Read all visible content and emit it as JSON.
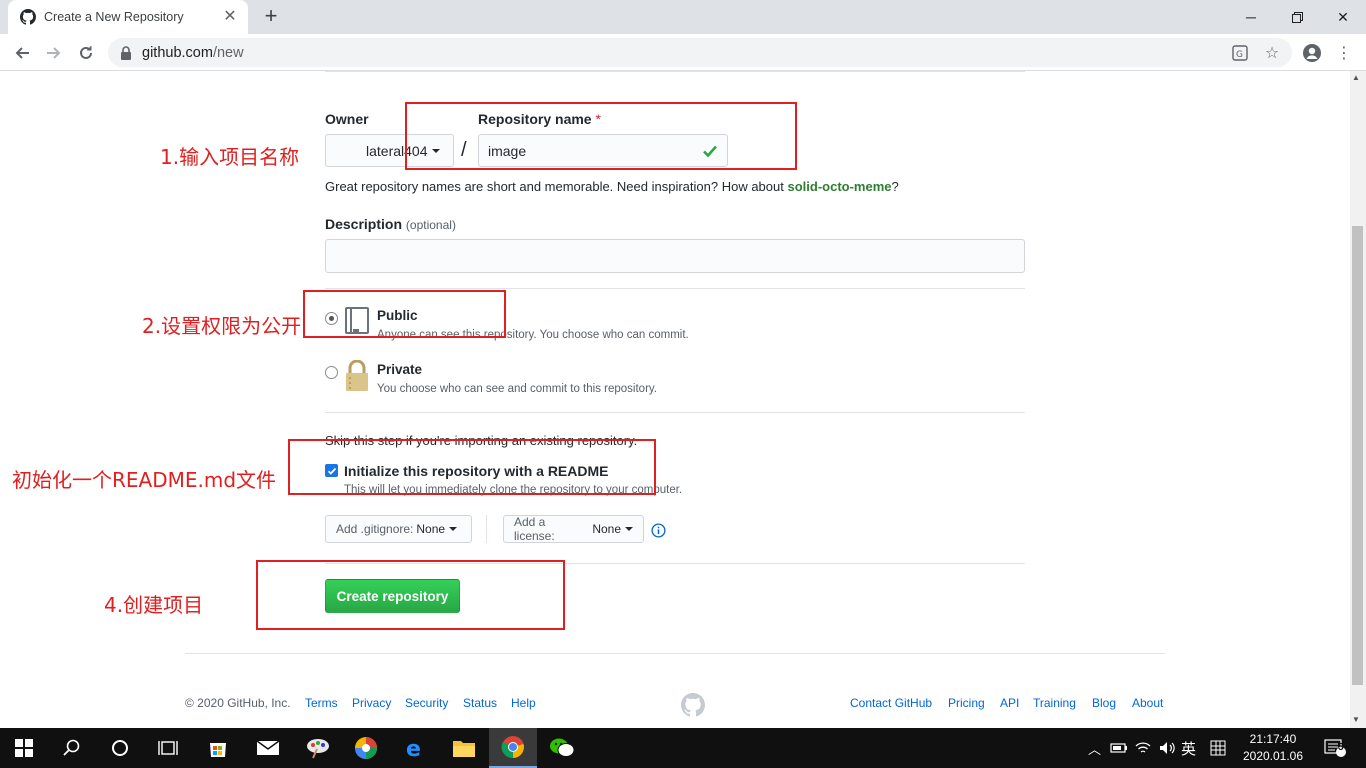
{
  "browser": {
    "tab_title": "Create a New Repository",
    "url_host": "github.com",
    "url_path": "/new"
  },
  "form": {
    "owner_label": "Owner",
    "owner_value": "lateral404",
    "repo_label": "Repository name",
    "required_mark": "*",
    "repo_value": "image",
    "hint_text": "Great repository names are short and memorable. Need inspiration? How about",
    "hint_suggestion": "solid-octo-meme",
    "hint_end": "?",
    "description_label": "Description",
    "description_optional": "(optional)",
    "public_title": "Public",
    "public_desc": "Anyone can see this repository. You choose who can commit.",
    "private_title": "Private",
    "private_desc": "You choose who can see and commit to this repository.",
    "selected_visibility": "Public",
    "skip_text": "Skip this step if you're importing an existing repository.",
    "init_readme_label": "Initialize this repository with a README",
    "init_readme_checked": true,
    "init_readme_desc": "This will let you immediately clone the repository to your computer.",
    "gitignore_label": "Add .gitignore:",
    "gitignore_value": "None",
    "license_label": "Add a license:",
    "license_value": "None",
    "create_button": "Create repository"
  },
  "annotations": {
    "step1": "1.输入项目名称",
    "step2": "2.设置权限为公开",
    "step3": "初始化一个README.md文件",
    "step4": "4.创建项目",
    "color": "#e02020"
  },
  "footer": {
    "copyright": "© 2020 GitHub, Inc.",
    "left_links": [
      "Terms",
      "Privacy",
      "Security",
      "Status",
      "Help"
    ],
    "right_links": [
      "Contact GitHub",
      "Pricing",
      "API",
      "Training",
      "Blog",
      "About"
    ]
  },
  "taskbar": {
    "ime": "英",
    "time": "21:17:40",
    "date": "2020.01.06",
    "notification_count": "5"
  },
  "colors": {
    "create_button": "#2ea44f",
    "link": "#0366d6",
    "suggestion": "#2f7d32",
    "checkmark": "#28a745"
  }
}
